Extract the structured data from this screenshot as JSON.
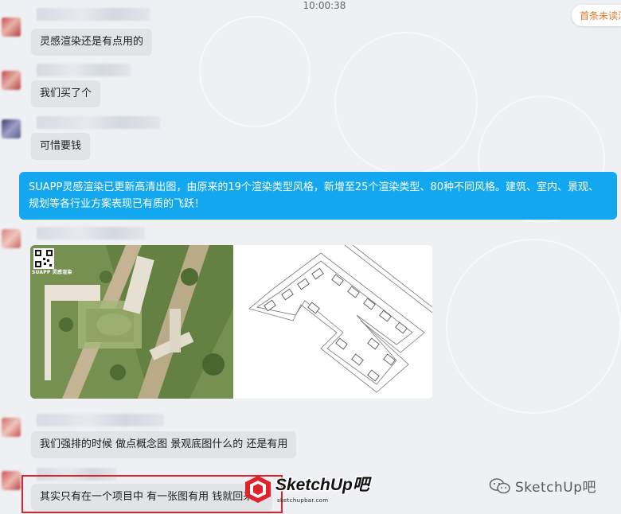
{
  "chat": {
    "timestamp": "10:00:38",
    "unread_label": "首条未读消息",
    "messages": [
      {
        "text": "灵感渲染还是有点用的"
      },
      {
        "text": "我们买了个"
      },
      {
        "text": "可惜要钱"
      },
      {
        "text": "SUAPP灵感渲染已更新高清出图，由原来的19个渲染类型风格，新增至25个渲染类型、80种不同风格。建筑、室内、景观、规划等各行业方案表现已有质的飞跃！"
      },
      {
        "text": "我们强排的时候 做点概念图 景观底图什么的 还是有用"
      },
      {
        "text": "其实只有在一个项目中 有一张图有用 钱就回来了"
      }
    ],
    "image_card": {
      "qr_caption": "SUAPP 灵感渲染"
    }
  },
  "watermark": {
    "logo_text": "SketchUp吧",
    "logo_url_text": "sketchupbar.com",
    "wechat_text": "SketchUp吧"
  },
  "colors": {
    "self_bubble": "#13a7f0",
    "other_bubble": "#e1e3e7",
    "highlight_border": "#e0232a",
    "unread_text": "#e2762a",
    "logo_red": "#e0232a"
  },
  "icons": {
    "wechat": "wechat-official-account-icon"
  }
}
